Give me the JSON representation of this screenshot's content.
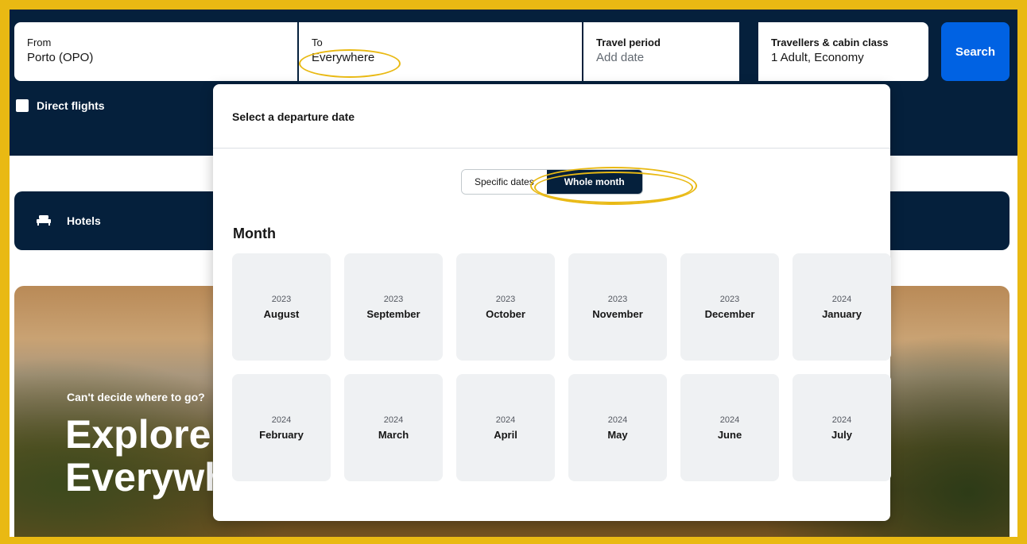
{
  "search": {
    "from_label": "From",
    "from_value": "Porto (OPO)",
    "to_label": "To",
    "to_value": "Everywhere",
    "period_label": "Travel period",
    "period_placeholder": "Add date",
    "travellers_label": "Travellers & cabin class",
    "travellers_value": "1 Adult, Economy",
    "search_button": "Search",
    "direct_flights_label": "Direct flights",
    "direct_flights_checked": false
  },
  "hotels": {
    "label": "Hotels",
    "icon": "bed-icon"
  },
  "hero": {
    "subtitle": "Can't decide where to go?",
    "title": "Explore\nEverywhere"
  },
  "date_picker": {
    "title": "Select a departure date",
    "toggle": {
      "options": [
        "Specific dates",
        "Whole month"
      ],
      "selected": "Whole month"
    },
    "month_heading": "Month",
    "months": [
      {
        "year": "2023",
        "month": "August"
      },
      {
        "year": "2023",
        "month": "September"
      },
      {
        "year": "2023",
        "month": "October"
      },
      {
        "year": "2023",
        "month": "November"
      },
      {
        "year": "2023",
        "month": "December"
      },
      {
        "year": "2024",
        "month": "January"
      },
      {
        "year": "2024",
        "month": "February"
      },
      {
        "year": "2024",
        "month": "March"
      },
      {
        "year": "2024",
        "month": "April"
      },
      {
        "year": "2024",
        "month": "May"
      },
      {
        "year": "2024",
        "month": "June"
      },
      {
        "year": "2024",
        "month": "July"
      }
    ]
  },
  "colors": {
    "frame_border": "#e9b913",
    "navy": "#05203c",
    "search_blue": "#0062e3",
    "highlight": "#e9b913",
    "month_cell": "#eff1f3"
  }
}
